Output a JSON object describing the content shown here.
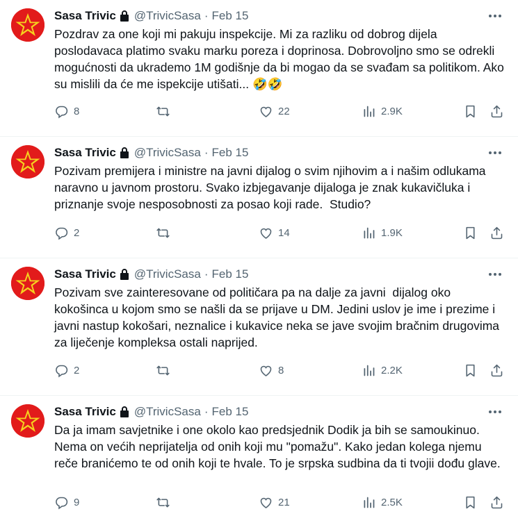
{
  "tweets": [
    {
      "name": "Sasa Trivic",
      "handle": "@TrivicSasa",
      "separator": "·",
      "date": "Feb 15",
      "text": "Pozdrav za one koji mi pakuju inspekcije. Mi za razliku od dobrog dijela poslodavaca platimo svaku marku poreza i doprinosa. Dobrovoljno smo se odrekli mogućnosti da ukrademo 1M godišnje da bi mogao da se svađam sa politikom. Ako su mislili da će me ispekcije utišati... 🤣🤣",
      "replies": "8",
      "retweets": "",
      "likes": "22",
      "views": "2.9K"
    },
    {
      "name": "Sasa Trivic",
      "handle": "@TrivicSasa",
      "separator": "·",
      "date": "Feb 15",
      "text": "Pozivam premijera i ministre na javni dijalog o svim njihovim a i našim odlukama naravno u javnom prostoru. Svako izbjegavanje dijaloga je znak kukavičluka i priznanje svoje nesposobnosti za posao koji rade.  Studio?",
      "replies": "2",
      "retweets": "",
      "likes": "14",
      "views": "1.9K"
    },
    {
      "name": "Sasa Trivic",
      "handle": "@TrivicSasa",
      "separator": "·",
      "date": "Feb 15",
      "text": "Pozivam sve zainteresovane od političara pa na dalje za javni  dijalog oko kokošinca u kojom smo se našli da se prijave u DM. Jedini uslov je ime i prezime i javni nastup kokošari, neznalice i kukavice neka se jave svojim bračnim drugovima za liječenje kompleksa ostali naprijed.",
      "replies": "2",
      "retweets": "",
      "likes": "8",
      "views": "2.2K"
    },
    {
      "name": "Sasa Trivic",
      "handle": "@TrivicSasa",
      "separator": "·",
      "date": "Feb 15",
      "text": "Da ja imam savjetnike i one okolo kao predsjednik Dodik ja bih se samoukinuo. Nema on većih neprijatelja od onih koji mu \"pomažu\". Kako jedan kolega njemu reče branićemo te od onih koji te hvale. To je srpska sudbina da ti tvojii dođu glave.",
      "replies": "9",
      "retweets": "",
      "likes": "21",
      "views": "2.5K"
    }
  ],
  "icons": {
    "avatar": "red-star-logo",
    "lock": "lock-icon",
    "more": "more-icon",
    "reply": "reply-icon",
    "retweet": "retweet-icon",
    "like": "heart-icon",
    "views": "views-icon",
    "bookmark": "bookmark-icon",
    "share": "share-icon"
  },
  "colors": {
    "text": "#0f1419",
    "secondary": "#536471",
    "divider": "#eff3f4",
    "avatar_bg": "#e21b1b",
    "star": "#f5d21f"
  }
}
